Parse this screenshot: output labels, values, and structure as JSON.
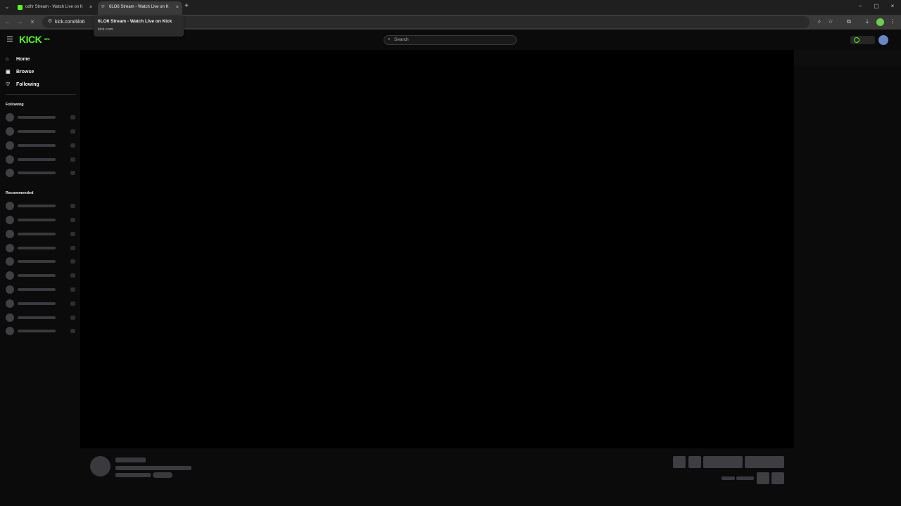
{
  "browser": {
    "tabs": [
      {
        "title": "odhr Stream - Watch Live on Ki",
        "active": false
      },
      {
        "title": "6LO6 Stream - Watch Live on K",
        "active": true
      }
    ],
    "tab_close_glyph": "×",
    "new_tab_glyph": "+",
    "window_controls": {
      "minimize": "–",
      "maximize": "▢",
      "close": "×"
    },
    "url": "kick.com/6lo6",
    "tooltip": {
      "title": "6LO6 Stream - Watch Live on Kick",
      "domain": "kick.com"
    }
  },
  "kick": {
    "logo_text": "KICK",
    "logo_badge": "BETA",
    "brand_color": "#53fc18",
    "search_placeholder": "Search",
    "nav": [
      {
        "label": "Home",
        "icon": "home-icon"
      },
      {
        "label": "Browse",
        "icon": "browse-icon"
      },
      {
        "label": "Following",
        "icon": "heart-icon"
      }
    ],
    "sections": {
      "following_label": "Following",
      "recommended_label": "Recommended"
    }
  }
}
